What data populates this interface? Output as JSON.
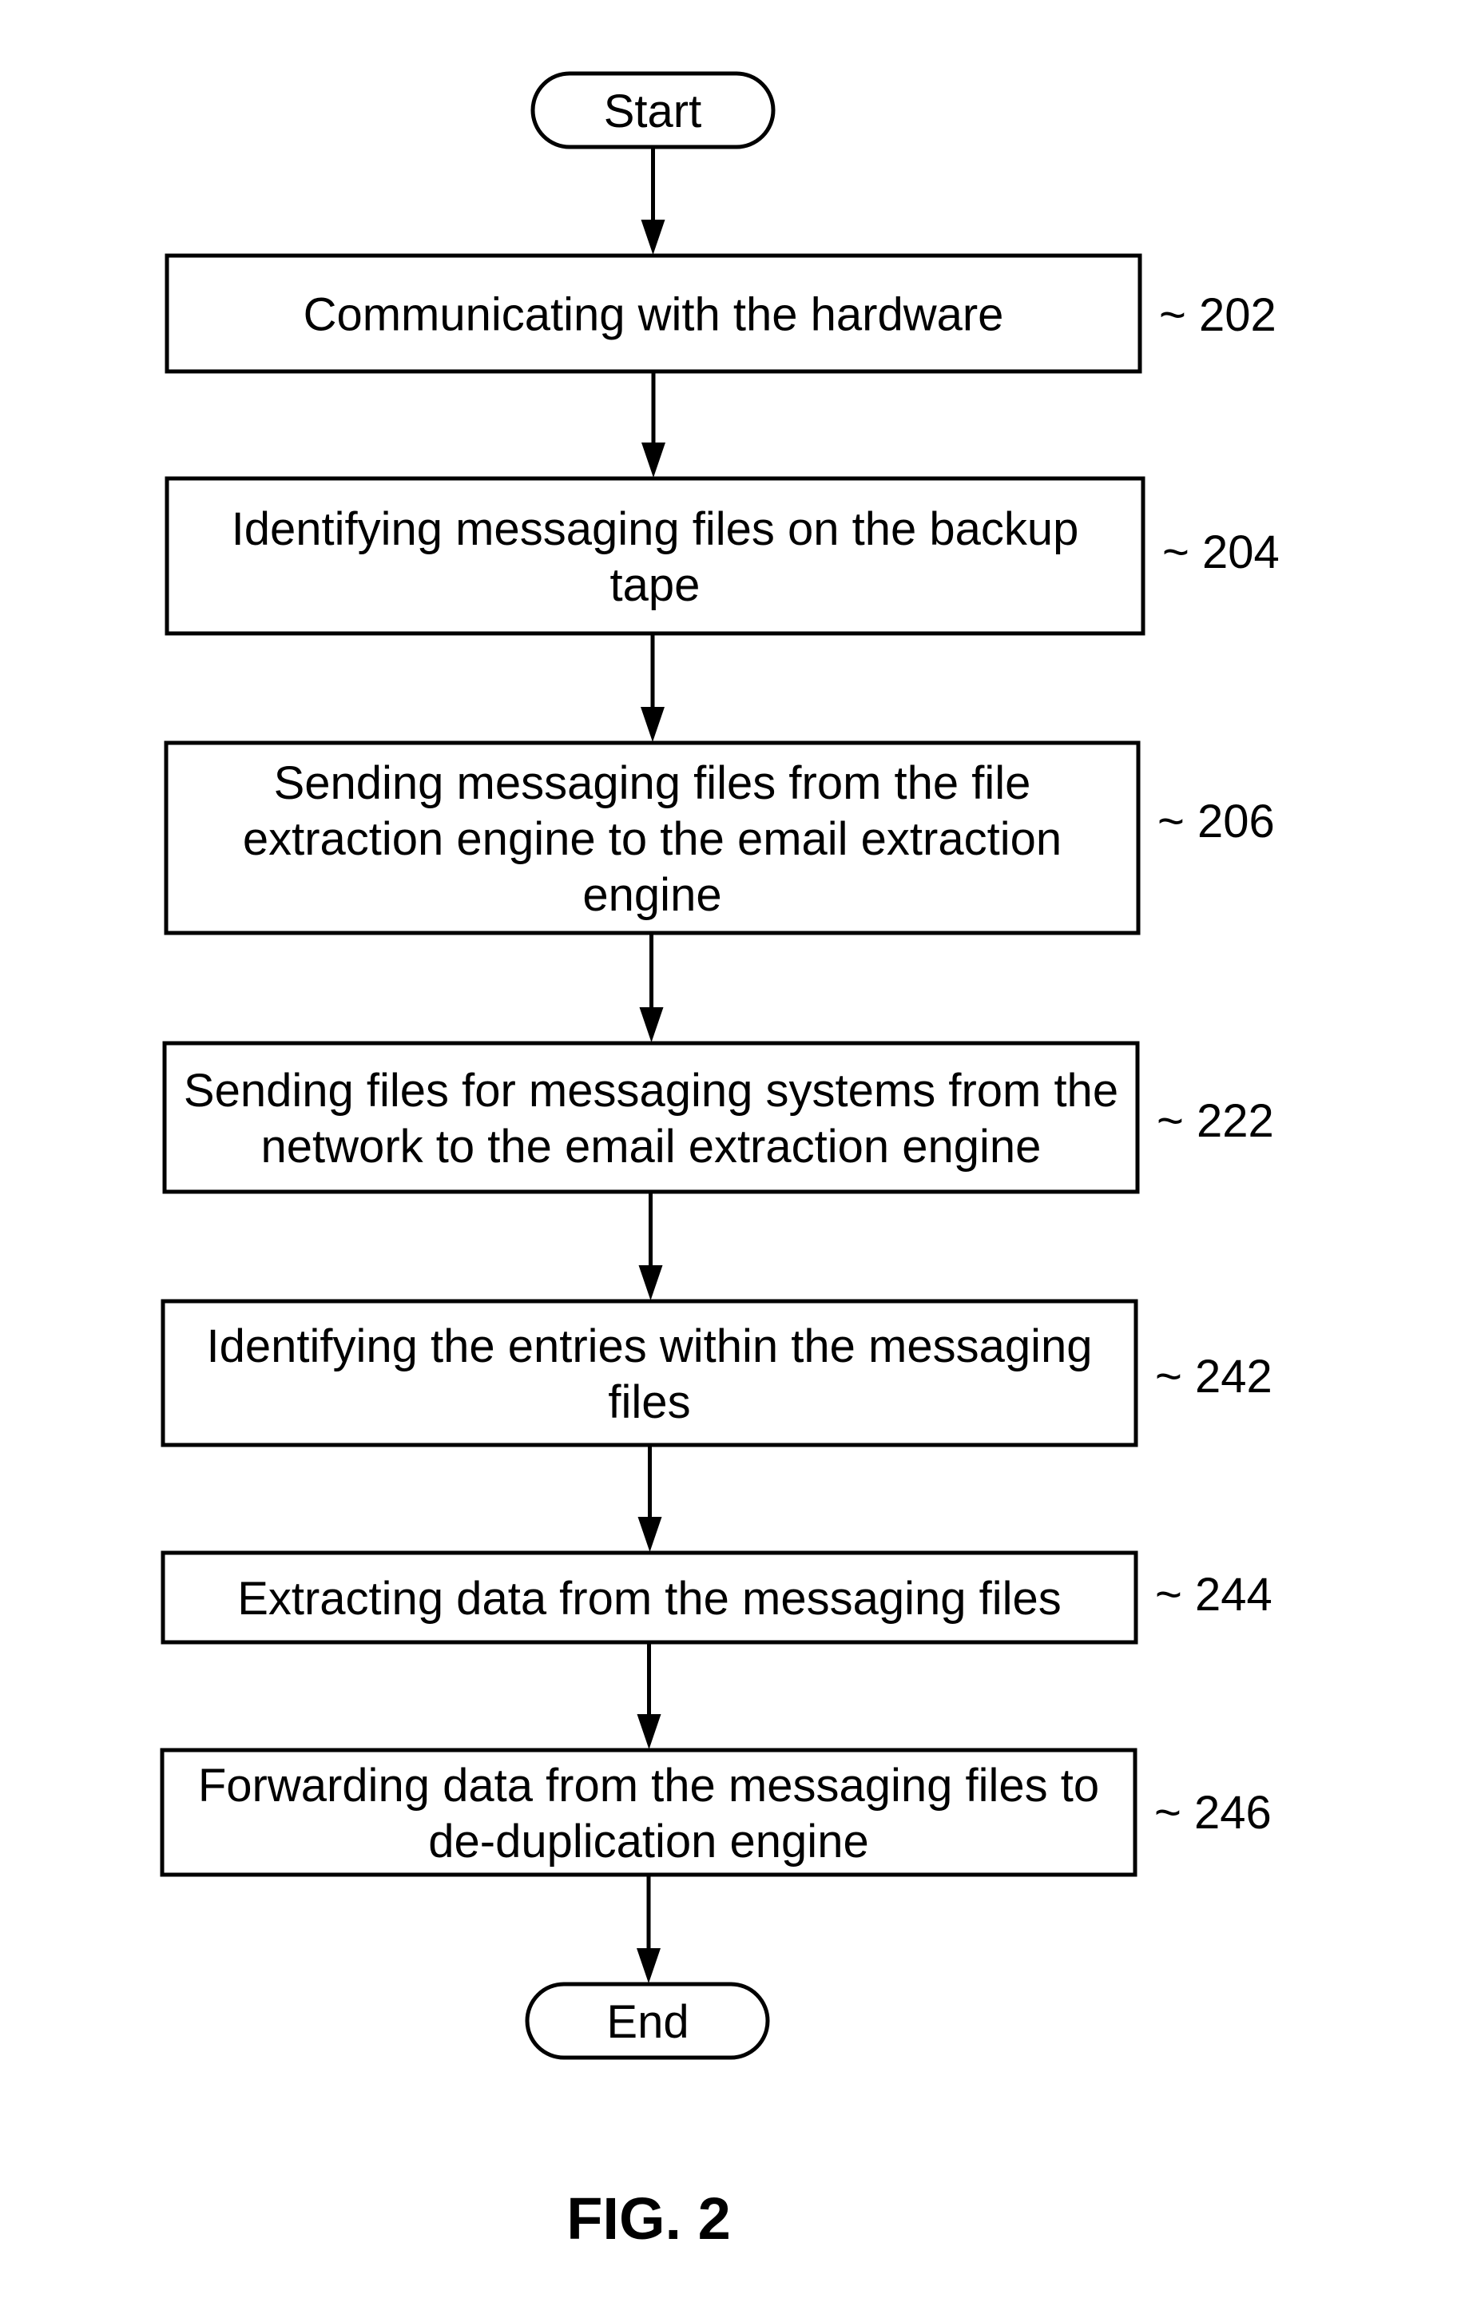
{
  "figure": {
    "caption": "FIG. 2",
    "start_label": "Start",
    "end_label": "End",
    "steps": [
      {
        "ref": "~ 202",
        "lines": [
          "Communicating with the hardware"
        ]
      },
      {
        "ref": "~ 204",
        "lines": [
          "Identifying messaging files on the backup",
          "tape"
        ]
      },
      {
        "ref": "~ 206",
        "lines": [
          "Sending messaging files from the file",
          "extraction engine to the email extraction",
          "engine"
        ]
      },
      {
        "ref": "~ 222",
        "lines": [
          "Sending files for messaging systems from the",
          "network to the email extraction engine"
        ]
      },
      {
        "ref": "~ 242",
        "lines": [
          "Identifying the entries within the messaging",
          "files"
        ]
      },
      {
        "ref": "~ 244",
        "lines": [
          "Extracting data from the messaging files"
        ]
      },
      {
        "ref": "~ 246",
        "lines": [
          "Forwarding data from the messaging files to",
          "de-duplication engine"
        ]
      }
    ],
    "colors": {
      "stroke": "#000000",
      "background": "#ffffff"
    }
  }
}
